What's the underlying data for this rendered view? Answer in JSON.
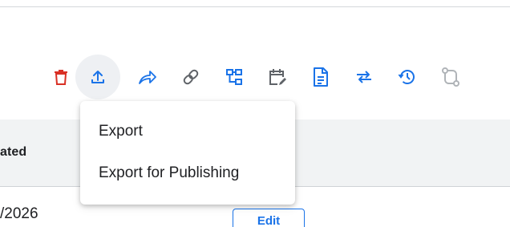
{
  "toolbar": {
    "buttons": [
      {
        "name": "delete-button",
        "icon": "trash-icon",
        "color": "#d93025"
      },
      {
        "name": "export-button",
        "icon": "upload-icon",
        "color": "#1a73e8",
        "active": true
      },
      {
        "name": "share-button",
        "icon": "share-arrow-icon",
        "color": "#1a73e8"
      },
      {
        "name": "link-button",
        "icon": "link-icon",
        "color": "#5f6368"
      },
      {
        "name": "hierarchy-button",
        "icon": "hierarchy-icon",
        "color": "#1a73e8"
      },
      {
        "name": "schedule-button",
        "icon": "calendar-edit-icon",
        "color": "#5f6368"
      },
      {
        "name": "document-button",
        "icon": "document-icon",
        "color": "#1a73e8"
      },
      {
        "name": "swap-button",
        "icon": "swap-arrows-icon",
        "color": "#1a73e8"
      },
      {
        "name": "history-button",
        "icon": "history-icon",
        "color": "#1a73e8"
      },
      {
        "name": "compare-button",
        "icon": "compare-path-icon",
        "color": "#b0b4b8"
      }
    ]
  },
  "export_menu": {
    "items": [
      "Export",
      "Export for Publishing"
    ]
  },
  "table": {
    "column_header": "ated",
    "first_row_date": "/2026",
    "edit_label": "Edit"
  },
  "colors": {
    "accent": "#1a73e8",
    "danger": "#d93025",
    "header_bg": "#f1f3f4"
  }
}
